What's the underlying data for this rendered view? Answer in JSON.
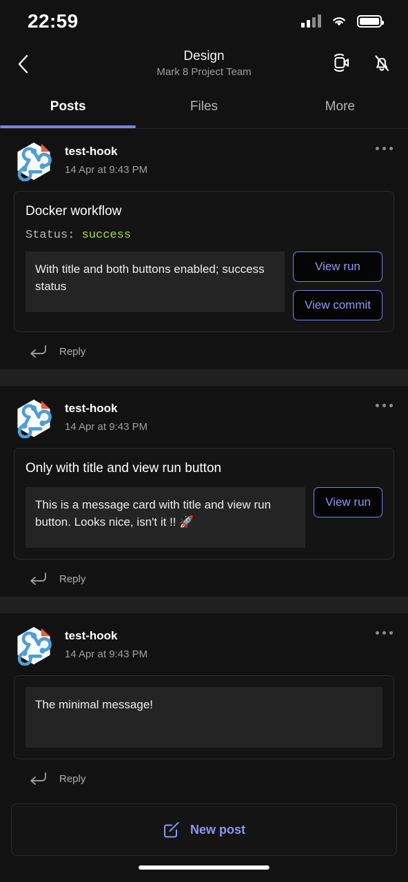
{
  "status_bar": {
    "time": "22:59",
    "signal_bars_filled": 2,
    "signal_bars_total": 4,
    "wifi": "wifi-icon",
    "battery": "battery-full-icon"
  },
  "header": {
    "back_icon": "chevron-left-icon",
    "title": "Design",
    "subtitle": "Mark 8 Project Team",
    "meet_icon": "video-camera-icon",
    "notifications_icon": "bell-off-icon"
  },
  "tabs": {
    "items": [
      {
        "label": "Posts",
        "active": true
      },
      {
        "label": "Files",
        "active": false
      },
      {
        "label": "More",
        "active": false
      }
    ],
    "active_color": "#7b83eb"
  },
  "posts": [
    {
      "author": "test-hook",
      "timestamp": "14 Apr at 9:43 PM",
      "avatar_icon": "webhook-avatar-icon",
      "more_icon": "more-options-icon",
      "card": {
        "title": "Docker workflow",
        "status_label": "Status:",
        "status_value": "success",
        "status_color": "#a6d957",
        "text": "With title and both buttons enabled; success status",
        "buttons": [
          "View run",
          "View commit"
        ]
      },
      "reply_label": "Reply",
      "reply_icon": "reply-arrow-icon"
    },
    {
      "author": "test-hook",
      "timestamp": "14 Apr at 9:43 PM",
      "avatar_icon": "webhook-avatar-icon",
      "more_icon": "more-options-icon",
      "card": {
        "title": "Only with title and view run button",
        "status_label": "",
        "status_value": "",
        "text": "This is a message card with title and view run button. Looks nice, isn't it !! 🚀",
        "buttons": [
          "View run"
        ]
      },
      "reply_label": "Reply",
      "reply_icon": "reply-arrow-icon"
    },
    {
      "author": "test-hook",
      "timestamp": "14 Apr at 9:43 PM",
      "avatar_icon": "webhook-avatar-icon",
      "more_icon": "more-options-icon",
      "card": {
        "title": "",
        "status_label": "",
        "status_value": "",
        "text": "The minimal message!",
        "buttons": []
      },
      "reply_label": "Reply",
      "reply_icon": "reply-arrow-icon"
    }
  ],
  "new_post": {
    "label": "New post",
    "icon": "compose-icon"
  }
}
